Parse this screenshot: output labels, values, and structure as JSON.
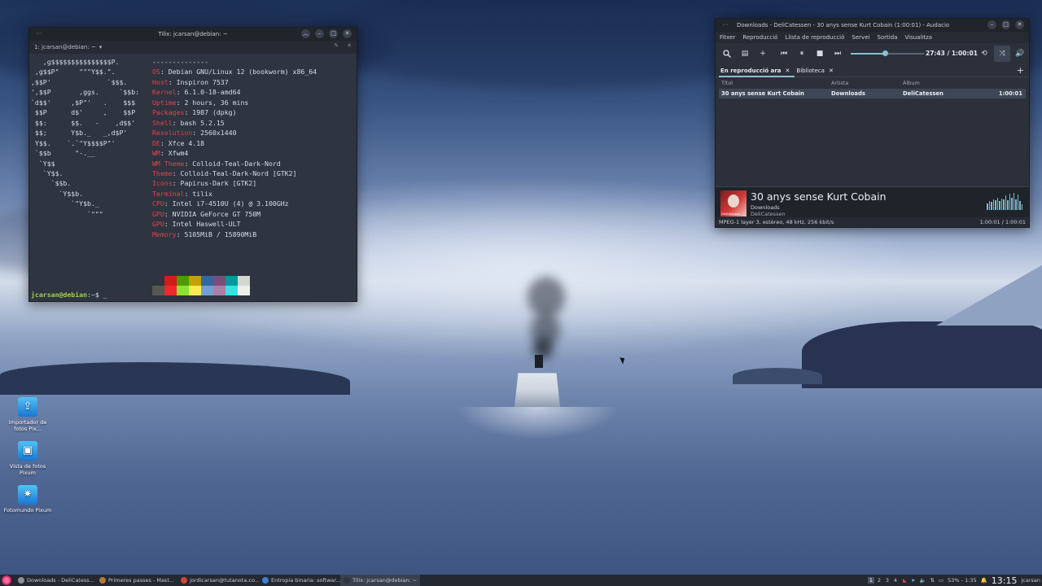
{
  "terminal": {
    "title": "Tilix: jcarsan@debian: ~",
    "tab_label": "1: jcarsan@debian: ~",
    "ascii_logo": [
      "      _,met$$$$$gg.",
      "   ,g$$$$$$$$$$$$$$$P.",
      " ,g$$P\"     \"\"\"Y$$.\".",
      ",$$P'              `$$$.",
      "',$$P       ,ggs.     `$$b:",
      "`d$$'     ,$P\"'   .    $$$",
      " $$P      d$'     ,    $$P",
      " $$:      $$.   -    ,d$$'",
      " $$;      Y$b._   _,d$P'",
      " Y$$.    `.`\"Y$$$$P\"'",
      " `$$b      \"-.__",
      "  `Y$$",
      "   `Y$$.",
      "     `$$b.",
      "       `Y$$b.",
      "          `\"Y$b._",
      "              `\"\"\""
    ],
    "ascii_logo_visible_from": 1,
    "header": "jcarsan@debian",
    "separator": "--------------",
    "info": [
      {
        "key": "OS",
        "value": "Debian GNU/Linux 12 (bookworm) x86_64"
      },
      {
        "key": "Host",
        "value": "Inspiron 7537"
      },
      {
        "key": "Kernel",
        "value": "6.1.0-18-amd64"
      },
      {
        "key": "Uptime",
        "value": "2 hours, 36 mins"
      },
      {
        "key": "Packages",
        "value": "1987 (dpkg)"
      },
      {
        "key": "Shell",
        "value": "bash 5.2.15"
      },
      {
        "key": "Resolution",
        "value": "2560x1440"
      },
      {
        "key": "DE",
        "value": "Xfce 4.18"
      },
      {
        "key": "WM",
        "value": "Xfwm4"
      },
      {
        "key": "WM Theme",
        "value": "Colloid-Teal-Dark-Nord"
      },
      {
        "key": "Theme",
        "value": "Colloid-Teal-Dark-Nord [GTK2]"
      },
      {
        "key": "Icons",
        "value": "Papirus-Dark [GTK2]"
      },
      {
        "key": "Terminal",
        "value": "tilix"
      },
      {
        "key": "CPU",
        "value": "Intel i7-4510U (4) @ 3.100GHz"
      },
      {
        "key": "GPU",
        "value": "NVIDIA GeForce GT 750M"
      },
      {
        "key": "GPU",
        "value": "Intel Haswell-ULT"
      },
      {
        "key": "Memory",
        "value": "5105MiB / 15890MiB"
      }
    ],
    "palette_top": [
      "#2e3440",
      "#d21c1c",
      "#4e9a06",
      "#c4a000",
      "#3465a4",
      "#75507b",
      "#06989a",
      "#d3d7cf"
    ],
    "palette_bottom": [
      "#555753",
      "#ef2929",
      "#8ae234",
      "#fce94f",
      "#729fcf",
      "#ad7fa8",
      "#34e2e2",
      "#eeeeec"
    ],
    "prompt_user": "jcarsan@debian",
    "prompt_path": ":~$ ",
    "cursor": "_"
  },
  "audacious": {
    "title": "Downloads - DeliCatessen - 30 anys sense Kurt Cobain (1:00:01) - Audacio",
    "menu": [
      "Fitxer",
      "Reproducció",
      "Llista de reproducció",
      "Servei",
      "Sortida",
      "Visualitza"
    ],
    "time": "27:43 / 1:00:01",
    "progress": 0.462,
    "tabs": [
      {
        "label": "En reproducció ara",
        "active": true
      },
      {
        "label": "Biblioteca",
        "active": false
      }
    ],
    "columns": {
      "title": "Títol",
      "artist": "Artista",
      "album": "Àlbum"
    },
    "rows": [
      {
        "title": "30 anys sense Kurt Cobain",
        "artist": "Downloads",
        "album": "DeliCatessen",
        "length": "1:00:01"
      }
    ],
    "now_playing": {
      "title": "30 anys sense Kurt Cobain",
      "artist": "Downloads",
      "album": "DeliCatessen"
    },
    "visualizer_levels": [
      0.35,
      0.5,
      0.45,
      0.6,
      0.55,
      0.7,
      0.5,
      0.65,
      0.6,
      0.8,
      0.55,
      0.9,
      0.7,
      0.95,
      0.6,
      0.85,
      0.5,
      0.3
    ],
    "status_left": "MPEG-1 layer 3, estèreo, 48 kHz, 256 kbit/s",
    "status_right": "1:00:01 / 1:00:01"
  },
  "desktop_icons": [
    {
      "label": "Importador de fotos Pix...",
      "icon": "photo-import-icon",
      "glyph": "⇪"
    },
    {
      "label": "Vista de fotos Pixum",
      "icon": "photo-viewer-icon",
      "glyph": "▣"
    },
    {
      "label": "Fotomundo Pixum",
      "icon": "fotomundo-icon",
      "glyph": "✷"
    }
  ],
  "taskbar": {
    "tasks": [
      {
        "label": "Downloads - DeliCatess...",
        "color": "#8a8f99",
        "active": false
      },
      {
        "label": "Primeres passes - Mast...",
        "color": "#b07a3a",
        "active": false
      },
      {
        "label": "jordicarsan@tutanota.co...",
        "color": "#d0463c",
        "active": false
      },
      {
        "label": "Entropia binaria: softwar...",
        "color": "#3f7fd6",
        "active": false
      },
      {
        "label": "Tilix: jcarsan@debian: ~",
        "color": "#2e3440",
        "active": true
      }
    ],
    "workspaces": [
      "1",
      "2",
      "3",
      "4"
    ],
    "current_workspace": "1",
    "battery": "53% - 1:35",
    "clock": "13:15",
    "user": "jcarsan"
  }
}
